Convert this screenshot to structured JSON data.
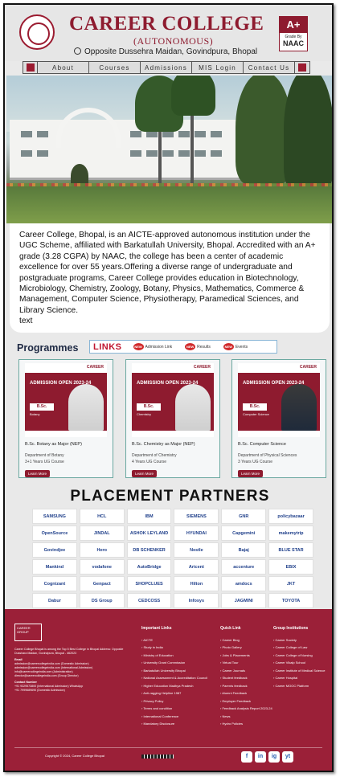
{
  "header": {
    "title": "CAREER COLLEGE",
    "subtitle": "(AUTONOMOUS)",
    "address": "Opposite Dussehra Maidan, Govindpura, Bhopal",
    "naac_grade": "A+",
    "naac_by": "Grade By",
    "naac_org": "NAAC"
  },
  "nav": {
    "items": [
      "About",
      "Courses",
      "Admissions",
      "MIS Login",
      "Contact Us"
    ]
  },
  "about": {
    "text": "Career College, Bhopal, is an AICTE-approved autonomous institution under the UGC Scheme, affiliated with Barkatullah University, Bhopal. Accredited with an A+ grade (3.28 CGPA) by NAAC, the college has been a center of academic excellence for over 55 years.Offering a diverse range of undergraduate and postgraduate programs, Career College provides education in Biotechnology, Microbiology, Chemistry, Zoology, Botany, Physics, Mathematics, Commerce & Management, Computer Science, Physiotherapy, Paramedical Sciences, and Library Science.",
    "extra": "text"
  },
  "programmes": {
    "heading": "Programmes",
    "links_title": "LINKS",
    "new_label": "NEW",
    "links": [
      "Admission Link",
      "Results",
      "Events"
    ],
    "cards": [
      {
        "name": "B.Sc. Botany as Major (NEP)",
        "dept": "Department of Botany",
        "duration": "3+1 Years UG Course",
        "poster_subject": "Botany",
        "learn": "Learn More"
      },
      {
        "name": "B.Sc. Chemistry as Major (NEP)",
        "dept": "Department of Chemistry",
        "duration": "4 Years UG Course",
        "poster_subject": "Chemistry",
        "learn": "Learn More"
      },
      {
        "name": "B.Sc. Computer Science",
        "dept": "Department of Physical Sciences",
        "duration": "3 Years UG Course",
        "poster_subject": "Computer Science",
        "learn": "Learn More"
      }
    ],
    "poster_brand": "CAREER",
    "poster_admission": "ADMISSION OPEN 2023-24",
    "poster_degree": "B.Sc."
  },
  "placement": {
    "title": "PLACEMENT PARTNERS",
    "partners": [
      "SAMSUNG",
      "HCL",
      "IBM",
      "SIEMENS",
      "GNR",
      "policybazaar",
      "OpenSource",
      "JINDAL",
      "ASHOK LEYLAND",
      "HYUNDAI",
      "Capgemini",
      "makemytrip",
      "Govindjee",
      "Hero",
      "DB SCHENKER",
      "Nestle",
      "Bajaj",
      "BLUE STAR",
      "Mankind",
      "vodafone",
      "AutoBridge",
      "Aricent",
      "accenture",
      "EBIX",
      "Cognizant",
      "Genpact",
      "SHOPCLUES",
      "Hilton",
      "amdocs",
      "JKT",
      "Dabur",
      "DS Group",
      "CEDCOSS",
      "Infosys",
      "JAGMINI",
      "TOYOTA"
    ]
  },
  "footer": {
    "logo_text": "CAREER GROUP",
    "about": "Career College Bhopal is among the Top 5 Best College in Bhopal Address: Opposite Dusshara Maidan, Govindpura, Bhopal - 462023",
    "email_label": "Email",
    "emails": [
      "admission@careercollegeindia.com (Domestic Admission)",
      "admission@careercollegeindia.com (International Admission)",
      "info@careercollegeindia.com (Administration)",
      "director@careercollegeindia.com (Group Director)"
    ],
    "contact_label": "Contact Number",
    "contacts": [
      "+91 9329573800 (International Admission) WhatsApp",
      "+91 7999689690 (Domestic Admission)"
    ],
    "columns": [
      {
        "head": "Important Links",
        "items": [
          "AICTE",
          "Study in India",
          "Ministry of Education",
          "University Grant Commission",
          "Barkatullah University Bhopal",
          "National Assessment & Accreditation Council",
          "Higher Education Madhya Pradesh",
          "Anti-ragging Helpline 1987",
          "Privacy Policy",
          "Terms and condition",
          "International Conference",
          "Mandatory Disclosure"
        ]
      },
      {
        "head": "Quick Link",
        "items": [
          "Career Blog",
          "Photo Gallery",
          "Jobs & Placements",
          "Virtual Tour",
          "Career Journals",
          "Student feedback",
          "Parents feedback",
          "Alumni Feedback",
          "Employer Feedback",
          "Feedback Analysis Report 2023-24",
          "News",
          "Hydro Policies"
        ]
      },
      {
        "head": "Group Institutions",
        "items": [
          "Career Society",
          "Career College of Law",
          "Career College of Nursing",
          "Career Vikalp School",
          "Career Institute of Medical Science",
          "Career Hospital",
          "Career MOOC Platform"
        ]
      }
    ],
    "copyright": "Copyright © 2024, Career College Bhopal",
    "social": [
      "f",
      "in",
      "ig",
      "yt"
    ]
  }
}
